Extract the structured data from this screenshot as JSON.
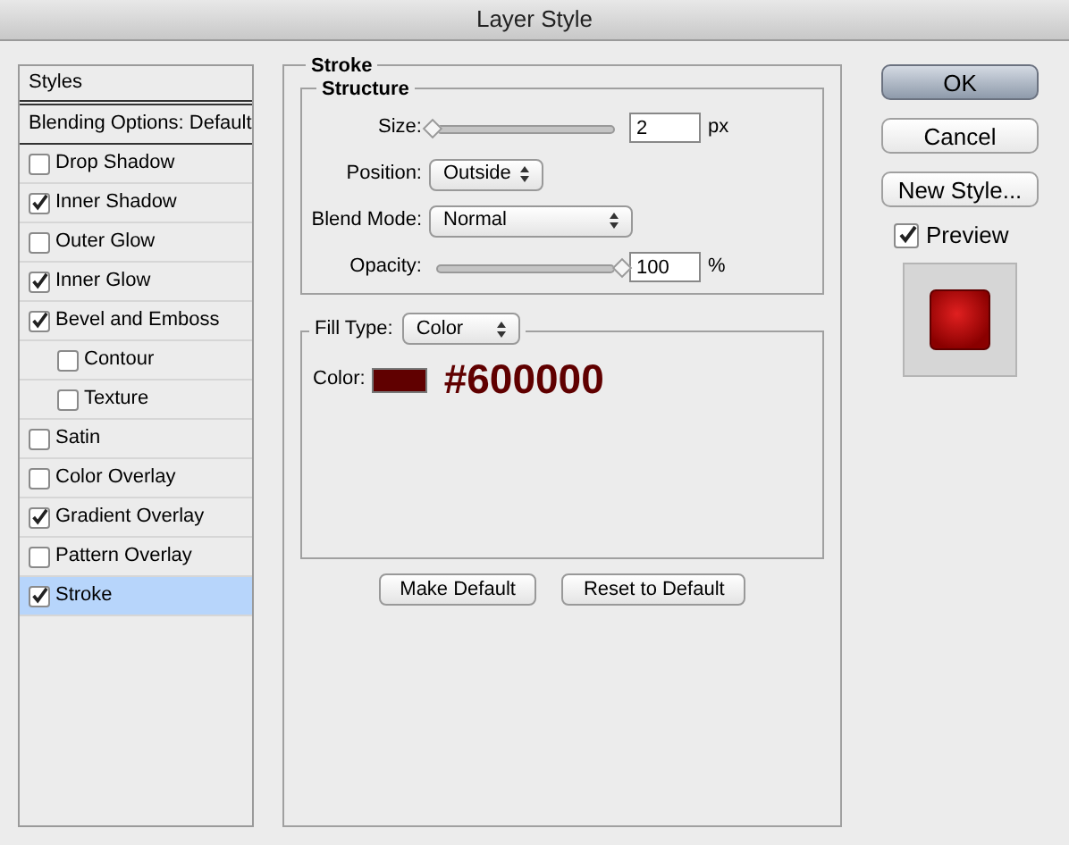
{
  "window": {
    "title": "Layer Style"
  },
  "styles": {
    "header": "Styles",
    "items": [
      {
        "kind": "plain",
        "label": "Blending Options: Default",
        "selected": false
      },
      {
        "kind": "check",
        "label": "Drop Shadow",
        "checked": false,
        "selected": false
      },
      {
        "kind": "check",
        "label": "Inner Shadow",
        "checked": true,
        "selected": false
      },
      {
        "kind": "check",
        "label": "Outer Glow",
        "checked": false,
        "selected": false
      },
      {
        "kind": "check",
        "label": "Inner Glow",
        "checked": true,
        "selected": false
      },
      {
        "kind": "check",
        "label": "Bevel and Emboss",
        "checked": true,
        "selected": false,
        "children": [
          {
            "kind": "check",
            "label": "Contour",
            "checked": false,
            "selected": false
          },
          {
            "kind": "check",
            "label": "Texture",
            "checked": false,
            "selected": false
          }
        ]
      },
      {
        "kind": "check",
        "label": "Satin",
        "checked": false,
        "selected": false
      },
      {
        "kind": "check",
        "label": "Color Overlay",
        "checked": false,
        "selected": false
      },
      {
        "kind": "check",
        "label": "Gradient Overlay",
        "checked": true,
        "selected": false
      },
      {
        "kind": "check",
        "label": "Pattern Overlay",
        "checked": false,
        "selected": false
      },
      {
        "kind": "check",
        "label": "Stroke",
        "checked": true,
        "selected": true
      }
    ]
  },
  "stroke": {
    "title": "Stroke",
    "structure": {
      "title": "Structure",
      "rows": [
        {
          "kind": "slider",
          "label": "Size:",
          "level": 0.02,
          "value": "2",
          "unit": "px"
        },
        {
          "kind": "select",
          "label": "Position:",
          "value": "Outside"
        },
        {
          "kind": "select",
          "label": "Blend Mode:",
          "value": "Normal",
          "wide": true
        },
        {
          "kind": "slider",
          "label": "Opacity:",
          "level": 1,
          "value": "100",
          "unit": "%"
        }
      ]
    },
    "fill": {
      "label": "Fill Type:",
      "value": "Color",
      "color_label": "Color:",
      "color_value": "#600000"
    },
    "buttons": [
      "Make Default",
      "Reset to Default"
    ]
  },
  "actions": [
    {
      "label": "OK",
      "default": true
    },
    {
      "label": "Cancel",
      "default": false
    },
    {
      "label": "New Style...",
      "default": false
    }
  ],
  "preview": {
    "label": "Preview",
    "checked": true
  }
}
